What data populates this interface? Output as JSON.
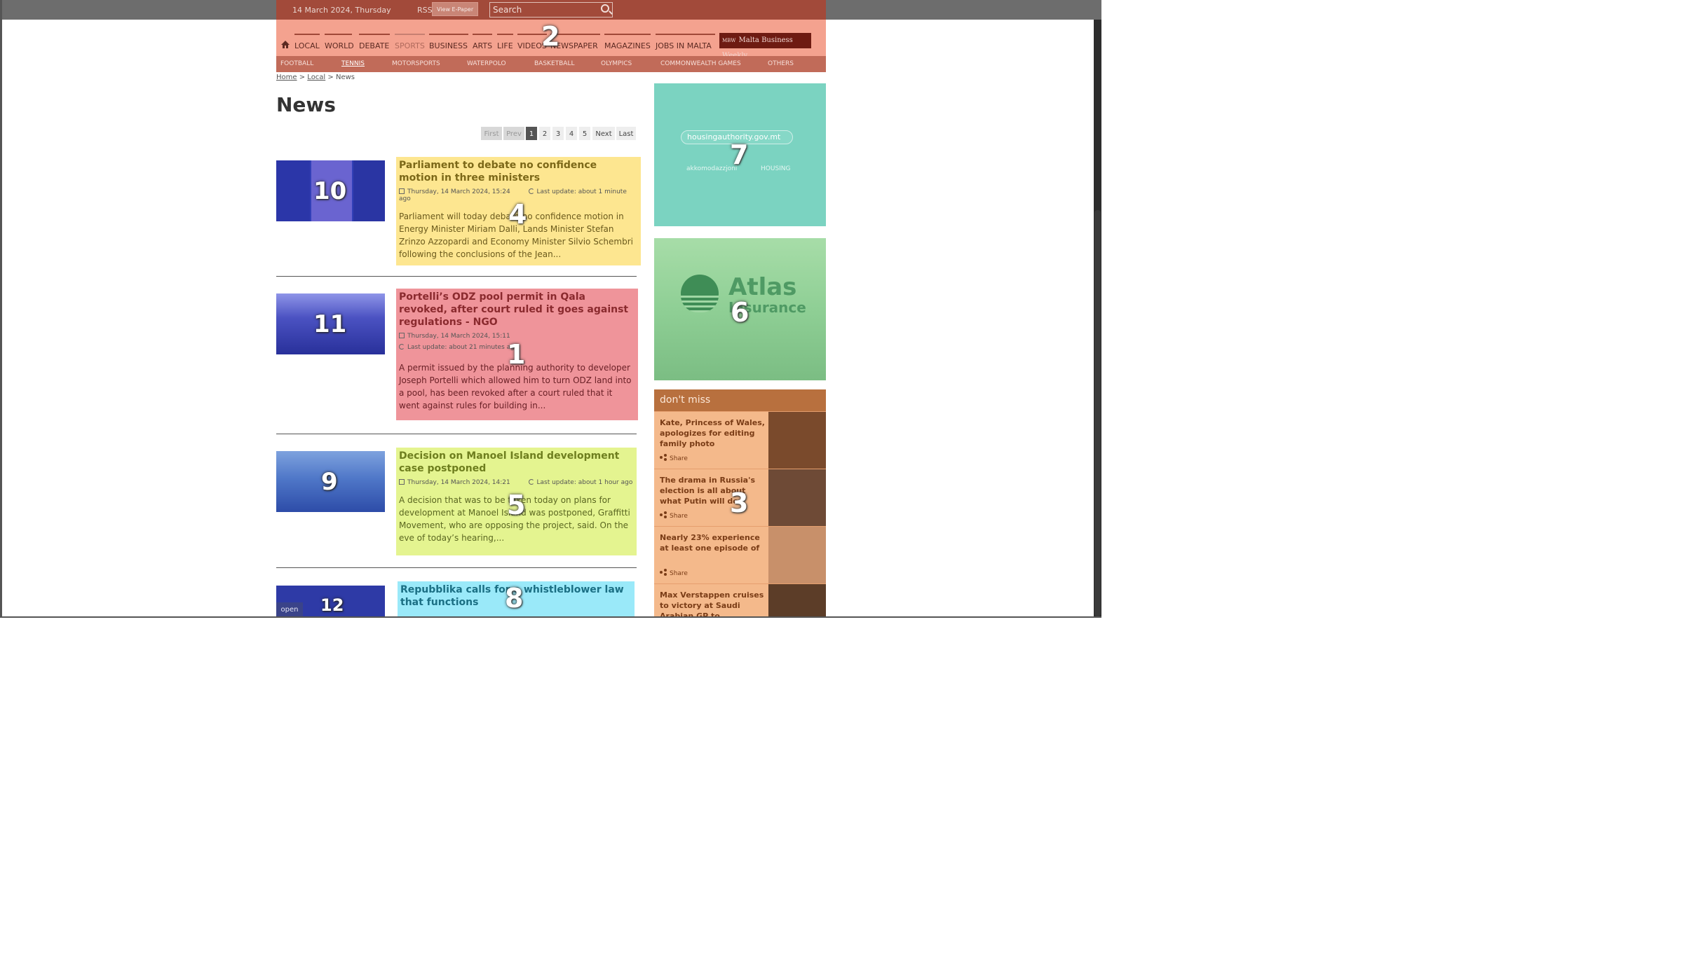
{
  "header": {
    "date": "14 March 2024, Thursday",
    "rss": "RSS",
    "epaper": "View E-Paper",
    "search_placeholder": "Search",
    "badge": "2"
  },
  "nav": {
    "items": [
      "LOCAL",
      "WORLD",
      "DEBATE",
      "SPORTS",
      "BUSINESS",
      "ARTS",
      "LIFE",
      "VIDEOS",
      "NEWSPAPER",
      "MAGAZINES",
      "JOBS IN MALTA"
    ],
    "mbw_short": "MBW",
    "mbw_label": "Malta Business Weekly"
  },
  "subnav": {
    "items": [
      "FOOTBALL",
      "TENNIS",
      "MOTORSPORTS",
      "WATERPOLO",
      "BASKETBALL",
      "OLYMPICS",
      "COMMONWEALTH GAMES",
      "OTHERS"
    ]
  },
  "breadcrumb": {
    "home": "Home",
    "sep": ">",
    "local": "Local",
    "current": "News"
  },
  "page_title": "News",
  "pager": [
    "First",
    "Prev",
    "1",
    "2",
    "3",
    "4",
    "5",
    "Next",
    "Last"
  ],
  "articles": [
    {
      "badge": "4",
      "thumb_badge": "10",
      "title": "Parliament to debate no confidence motion in three ministers",
      "date": "Thursday, 14 March 2024, 15:24",
      "update": "Last update: about 1 minute ago",
      "excerpt": "Parliament will today debate no confidence motion in Energy Minister Miriam Dalli, Lands Minister Stefan Zrinzo Azzopardi and Economy Minister Silvio Schembri following the conclusions of the Jean..."
    },
    {
      "badge": "1",
      "thumb_badge": "11",
      "title": "Portelli’s ODZ pool permit in Qala revoked, after court ruled it goes against regulations - NGO",
      "date": "Thursday, 14 March 2024, 15:11",
      "update": "Last update: about 21 minutes ago",
      "excerpt": "A permit issued by the planning authority to developer Joseph Portelli which allowed him to turn ODZ land into a pool, has been revoked after a court ruled that it went against rules for building in..."
    },
    {
      "badge": "5",
      "thumb_badge": "9",
      "title": "Decision on Manoel Island development case postponed",
      "date": "Thursday, 14 March 2024, 14:21",
      "update": "Last update: about 1 hour ago",
      "excerpt": "A decision that was to be taken today on plans for development at Manoel Island was postponed, Graffitti Movement, who are opposing the project, said. On the eve of today’s hearing,..."
    },
    {
      "badge": "8",
      "thumb_badge": "12",
      "thumb_label": "open",
      "title": "Repubblika calls for a whistleblower law that functions"
    }
  ],
  "ads": {
    "housing": {
      "badge": "7",
      "url": "housingauthority.gov.mt",
      "tag": "akkomodazzjoni",
      "brand": "HOUSING"
    },
    "atlas": {
      "badge": "6",
      "brand1": "Atlas",
      "brand2": "Insurance"
    }
  },
  "dont_miss": {
    "title": "don't miss",
    "badge": "3",
    "share": "Share",
    "items": [
      "Kate, Princess of Wales, apologizes for editing family photo",
      "The drama in Russia's election is all about what Putin will do",
      "Nearly 23% experience at least one episode of",
      "Max Verstappen cruises to victory at Saudi Arabian GP to"
    ]
  }
}
